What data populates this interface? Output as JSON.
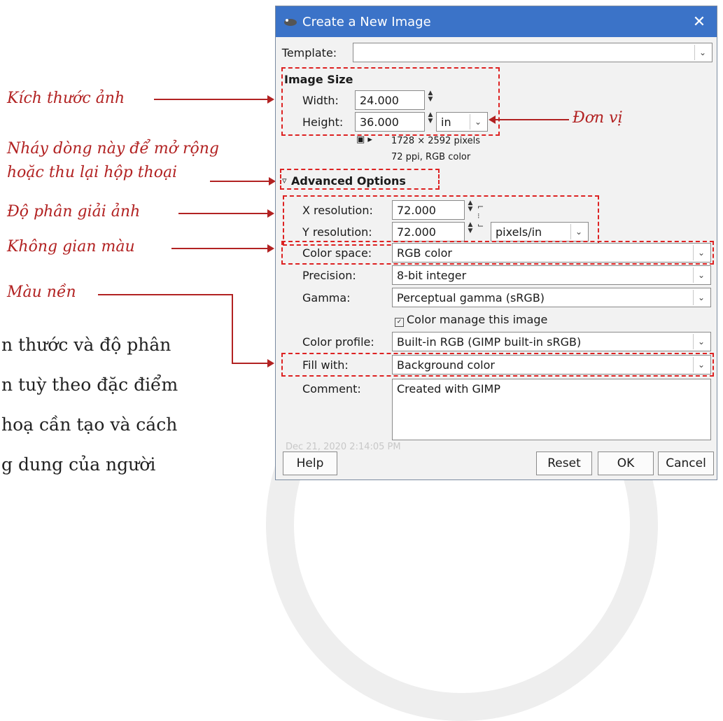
{
  "annotations": {
    "image_size": "Kích thước ảnh",
    "units": "Đơn vị",
    "expand_line1": "Nháy dòng này để mở rộng",
    "expand_line2": "hoặc thu lại hộp thoại",
    "resolution": "Độ phân giải ảnh",
    "color_space": "Không gian màu",
    "background": "Màu nền"
  },
  "body_text": {
    "line1": "n thước và độ phân",
    "line2": "n tuỳ theo đặc điểm",
    "line3": "hoạ cần tạo và cách",
    "line4": "g dung của người"
  },
  "dialog": {
    "title": "Create a New Image",
    "close": "✕",
    "template_label": "Template:",
    "template_value": "",
    "image_size_label": "Image Size",
    "width_label": "Width:",
    "width_value": "24.000",
    "height_label": "Height:",
    "height_value": "36.000",
    "unit_value": "in",
    "pixels_info": "1728 × 2592 pixels",
    "ppi_info": "72 ppi, RGB color",
    "advanced_label": "Advanced Options",
    "xres_label": "X resolution:",
    "xres_value": "72.000",
    "yres_label": "Y resolution:",
    "yres_value": "72.000",
    "res_unit": "pixels/in",
    "colorspace_label": "Color space:",
    "colorspace_value": "RGB color",
    "precision_label": "Precision:",
    "precision_value": "8-bit integer",
    "gamma_label": "Gamma:",
    "gamma_value": "Perceptual gamma (sRGB)",
    "color_manage_label": "Color manage this image",
    "color_manage_checked": true,
    "color_profile_label": "Color profile:",
    "color_profile_value": "Built-in RGB (GIMP built-in sRGB)",
    "fill_label": "Fill with:",
    "fill_value": "Background color",
    "comment_label": "Comment:",
    "comment_value": "Created with GIMP",
    "date_stamp": "Dec 21, 2020 2:14:05 PM",
    "help_button": "Help",
    "reset_button": "Reset",
    "ok_button": "OK",
    "cancel_button": "Cancel"
  },
  "colors": {
    "titlebar": "#3b73c8",
    "annotation": "#b22222",
    "highlight": "#dd2222"
  }
}
